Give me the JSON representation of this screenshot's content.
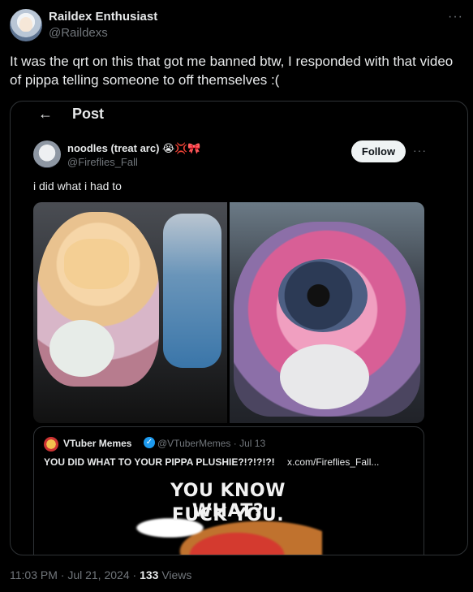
{
  "header": {
    "name": "Raildex Enthusiast",
    "handle": "@Raildexs",
    "more": "···"
  },
  "tweet": {
    "text": "It was the qrt on this that got me banned btw, I responded with that video of pippa telling someone to off themselves :("
  },
  "embed": {
    "back": "←",
    "title": "Post",
    "reply": {
      "name": "noodles (treat arc) 😭💢🎀",
      "handle": "@Fireflies_Fall",
      "follow_label": "Follow",
      "more": "···",
      "text": "i did what i had to"
    },
    "quote": {
      "name": "VTuber Memes",
      "verified": "✓",
      "handle": "@VTuberMemes · Jul 13",
      "text": "YOU DID WHAT TO YOUR PIPPA PLUSHIE?!?!?!?!",
      "link": "x.com/Fireflies_Fall...",
      "meme_line1": "YOU KNOW WHAT?",
      "meme_line2": "FUCK YOU."
    }
  },
  "footer": {
    "timestamp": "11:03 PM · Jul 21, 2024 ·",
    "views_count": "133",
    "views_label": "Views"
  }
}
